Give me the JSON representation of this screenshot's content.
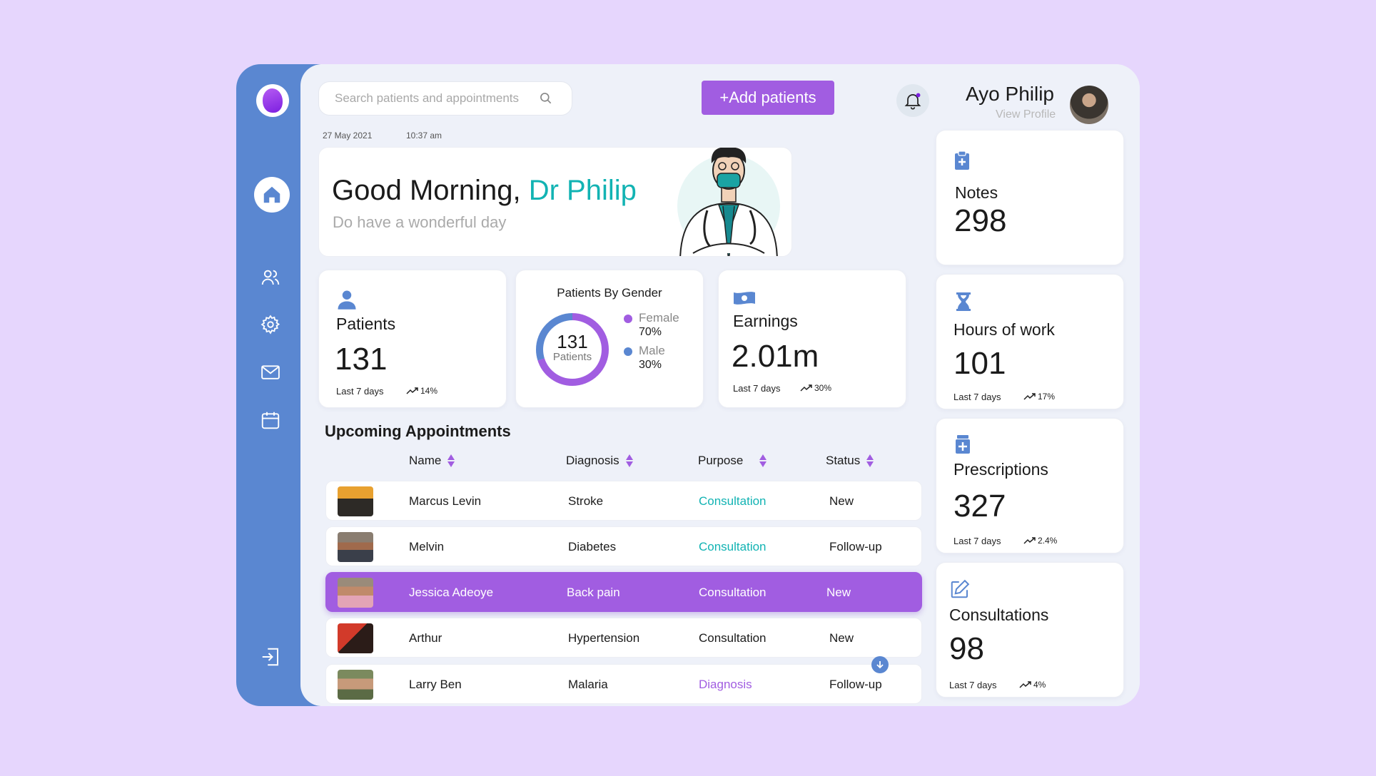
{
  "search": {
    "placeholder": "Search patients and appointments",
    "icon": "search-icon"
  },
  "header": {
    "add_button": "+Add patients",
    "bell_icon": "bell-icon",
    "user_name": "Ayo Philip",
    "view_profile": "View Profile"
  },
  "timestamp": {
    "date": "27 May 2021",
    "time": "10:37 am"
  },
  "greeting": {
    "hello": "Good Morning, ",
    "name": "Dr Philip",
    "subtitle": "Do have a wonderful day"
  },
  "stats": {
    "patients": {
      "label": "Patients",
      "value": "131",
      "period": "Last 7 days",
      "trend": "14%"
    },
    "gender": {
      "title": "Patients By Gender",
      "total": "131",
      "total_label": "Patients",
      "female": {
        "label": "Female",
        "pct": "70%",
        "fraction": 0.7,
        "color": "#a15de1"
      },
      "male": {
        "label": "Male",
        "pct": "30%",
        "fraction": 0.3,
        "color": "#5a87d1"
      }
    },
    "earnings": {
      "label": "Earnings",
      "value": "2.01m",
      "period": "Last 7 days",
      "trend": "30%"
    },
    "notes": {
      "label": "Notes",
      "value": "298"
    },
    "hours": {
      "label": "Hours of work",
      "value": "101",
      "period": "Last 7 days",
      "trend": "17%"
    },
    "prescriptions": {
      "label": "Prescriptions",
      "value": "327",
      "period": "Last 7 days",
      "trend": "2.4%"
    },
    "consultations": {
      "label": "Consultations",
      "value": "98",
      "period": "Last 7 days",
      "trend": "4%"
    }
  },
  "appointments": {
    "title": "Upcoming Appointments",
    "columns": [
      "Name",
      "Diagnosis",
      "Purpose",
      "Status"
    ],
    "rows": [
      {
        "name": "Marcus Levin",
        "diagnosis": "Stroke",
        "purpose": "Consultation",
        "status": "New"
      },
      {
        "name": "Melvin",
        "diagnosis": "Diabetes",
        "purpose": "Consultation",
        "status": "Follow-up"
      },
      {
        "name": "Jessica Adeoye",
        "diagnosis": "Back pain",
        "purpose": "Consultation",
        "status": "New"
      },
      {
        "name": "Arthur",
        "diagnosis": "Hypertension",
        "purpose": "Consultation",
        "status": "New"
      },
      {
        "name": "Larry Ben",
        "diagnosis": "Malaria",
        "purpose": "Diagnosis",
        "status": "Follow-up"
      }
    ]
  },
  "colors": {
    "accent": "#a15de1",
    "sidebar": "#5a87d1",
    "teal": "#12b3b3",
    "background": "#e6d6fd"
  }
}
